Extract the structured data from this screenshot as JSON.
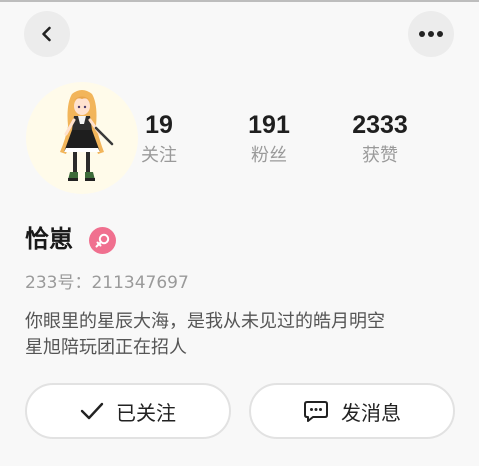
{
  "header": {
    "back_icon": "chevron-left-icon",
    "more_icon": "more-dots-icon"
  },
  "profile": {
    "avatar": "anime-character-avatar",
    "stats": [
      {
        "value": "19",
        "label": "关注"
      },
      {
        "value": "191",
        "label": "粉丝"
      },
      {
        "value": "2333",
        "label": "获赞"
      }
    ],
    "name": "恰崽",
    "gender_icon": "female-icon",
    "gender_color": "#f0708f",
    "uid": "233号：211347697",
    "bio_line1": "你眼里的星辰大海，是我从未见过的皓月明空",
    "bio_line2": "星旭陪玩团正在招人"
  },
  "actions": {
    "follow_label": "已关注",
    "follow_icon": "checkmark-icon",
    "message_label": "发消息",
    "message_icon": "chat-bubble-icon"
  }
}
